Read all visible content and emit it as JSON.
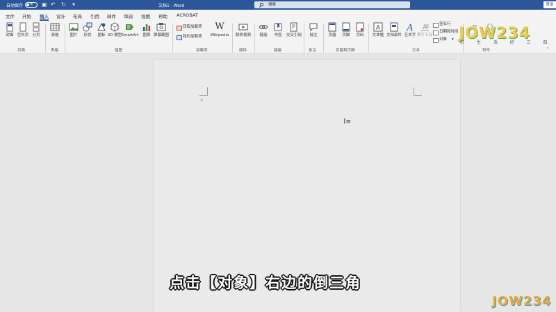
{
  "titlebar": {
    "autosave_label": "自动保存",
    "autosave_state": "关",
    "doc_title": "文档1 - Word",
    "search_placeholder": "搜索",
    "signin_label": "登录"
  },
  "menu": {
    "tabs": [
      "文件",
      "开始",
      "插入",
      "设计",
      "布局",
      "引用",
      "邮件",
      "审阅",
      "视图",
      "帮助",
      "ACROBAT"
    ],
    "active_tab": "插入"
  },
  "ribbon": {
    "pages_group": {
      "label": "页面",
      "items": [
        "封面",
        "空白页",
        "分页"
      ]
    },
    "table_group": {
      "label": "表格",
      "items": [
        "表格"
      ]
    },
    "illustrations_group": {
      "label": "插图",
      "items": [
        "图片",
        "形状",
        "图标",
        "3D 模型",
        "SmartArt",
        "图表",
        "屏幕截图"
      ]
    },
    "addins_group": {
      "label": "加载项",
      "items": [
        "获取加载项",
        "我的加载项",
        "Wikipedia"
      ]
    },
    "media_group": {
      "label": "媒体",
      "items": [
        "联机视频"
      ]
    },
    "links_group": {
      "label": "链接",
      "items": [
        "链接",
        "书签",
        "交叉引用"
      ]
    },
    "comments_group": {
      "label": "批注",
      "items": [
        "批注"
      ]
    },
    "header_footer_group": {
      "label": "页眉和页脚",
      "items": [
        "页眉",
        "页脚",
        "页码"
      ]
    },
    "text_group": {
      "label": "文本",
      "items": [
        "文本框",
        "文档部件",
        "艺术字",
        "首字下沉",
        "签名行",
        "日期和时间",
        "对象"
      ]
    },
    "symbols_group": {
      "label": "符号",
      "items": [
        "公式",
        "符号"
      ]
    }
  },
  "document": {
    "paragraph_mark": "↵"
  },
  "subtitle": "点击【对象】右边的倒三角",
  "watermark": {
    "logo_text": "JOW234",
    "logo_sub": "好 生 活 好 三 四"
  },
  "colors": {
    "word_blue": "#2b579a",
    "ribbon_bg": "#f3f3f3",
    "canvas_bg": "#e6e6e6"
  }
}
